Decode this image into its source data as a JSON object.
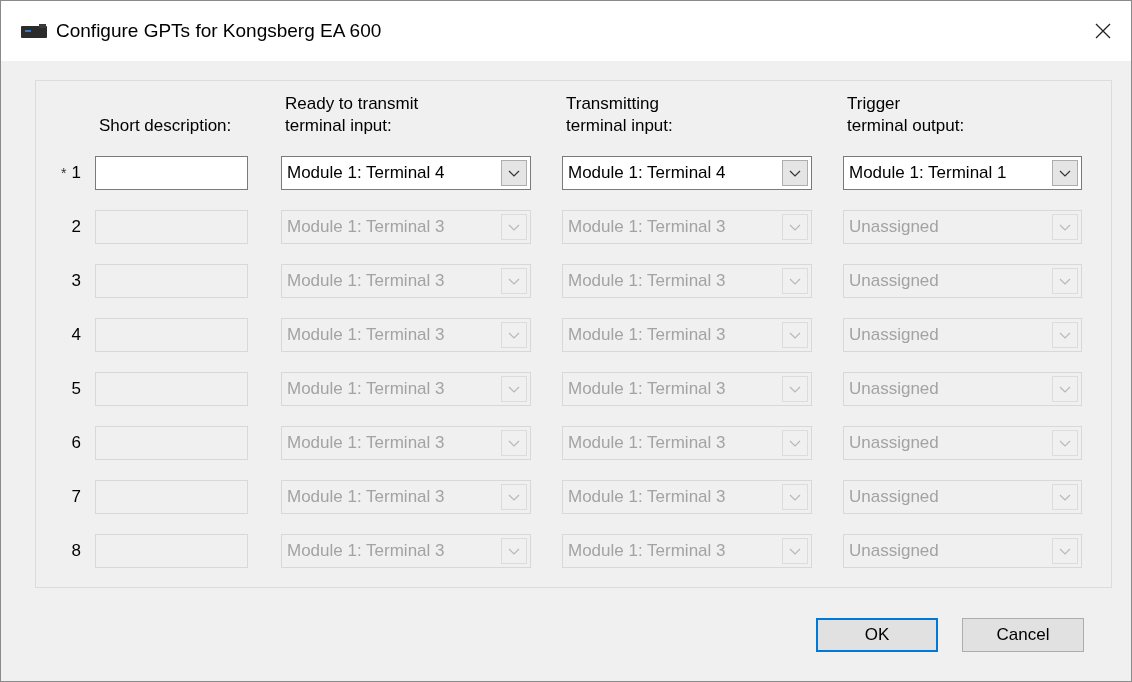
{
  "window": {
    "title": "Configure GPTs for Kongsberg EA 600"
  },
  "headers": [
    "Short description:",
    "Ready to transmit\nterminal input:",
    "Transmitting\nterminal input:",
    "Trigger\nterminal output:"
  ],
  "rows": [
    {
      "marker": "*",
      "number": "1",
      "enabled": true,
      "values": [
        "Module 1: Terminal 4",
        "Module 1: Terminal 4",
        "Module 1: Terminal 1"
      ]
    },
    {
      "number": "2",
      "enabled": false,
      "values": [
        "Module 1: Terminal 3",
        "Module 1: Terminal 3",
        "Unassigned"
      ]
    },
    {
      "number": "3",
      "enabled": false,
      "values": [
        "Module 1: Terminal 3",
        "Module 1: Terminal 3",
        "Unassigned"
      ]
    },
    {
      "number": "4",
      "enabled": false,
      "values": [
        "Module 1: Terminal 3",
        "Module 1: Terminal 3",
        "Unassigned"
      ]
    },
    {
      "number": "5",
      "enabled": false,
      "values": [
        "Module 1: Terminal 3",
        "Module 1: Terminal 3",
        "Unassigned"
      ]
    },
    {
      "number": "6",
      "enabled": false,
      "values": [
        "Module 1: Terminal 3",
        "Module 1: Terminal 3",
        "Unassigned"
      ]
    },
    {
      "number": "7",
      "enabled": false,
      "values": [
        "Module 1: Terminal 3",
        "Module 1: Terminal 3",
        "Unassigned"
      ]
    },
    {
      "number": "8",
      "enabled": false,
      "values": [
        "Module 1: Terminal 3",
        "Module 1: Terminal 3",
        "Unassigned"
      ]
    }
  ],
  "buttons": [
    {
      "label": "OK",
      "default": true
    },
    {
      "label": "Cancel",
      "default": false
    }
  ]
}
